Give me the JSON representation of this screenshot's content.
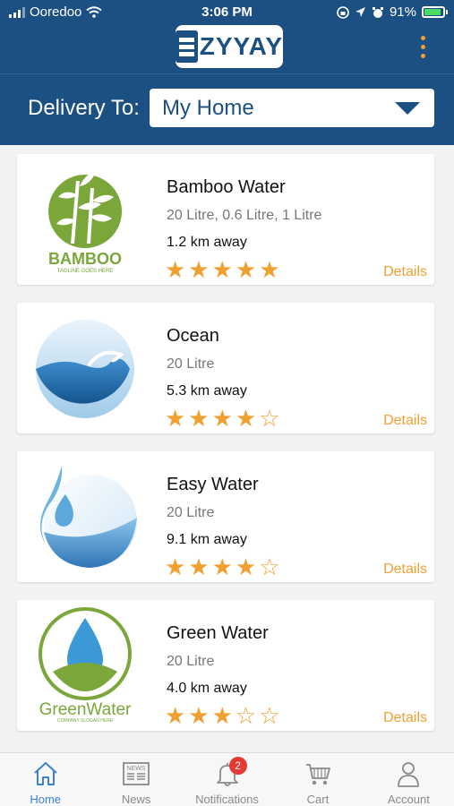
{
  "status_bar": {
    "carrier": "Ooredoo",
    "time": "3:06 PM",
    "battery": "91%"
  },
  "header": {
    "logo_text": "ZYYAY",
    "delivery_label": "Delivery To:",
    "delivery_value": "My Home"
  },
  "colors": {
    "brand": "#1c5083",
    "accent": "#f0a030",
    "active_tab": "#3b82d6",
    "badge": "#e53935"
  },
  "suppliers": [
    {
      "name": "Bamboo Water",
      "sizes": "20 Litre, 0.6 Litre, 1 Litre",
      "distance": "1.2 km away",
      "rating": 5,
      "rating_stars": "★★★★★",
      "details": "Details",
      "logo_text": "BAMBOO",
      "logo_tagline": "TAGLINE GOES HERE"
    },
    {
      "name": "Ocean",
      "sizes": "20 Litre",
      "distance": "5.3 km away",
      "rating": 4,
      "rating_stars": "★★★★☆",
      "details": "Details"
    },
    {
      "name": "Easy Water",
      "sizes": "20 Litre",
      "distance": "9.1 km away",
      "rating": 4,
      "rating_stars": "★★★★☆",
      "details": "Details"
    },
    {
      "name": "Green Water",
      "sizes": "20 Litre",
      "distance": "4.0 km away",
      "rating": 3,
      "rating_stars": "★★★☆☆",
      "details": "Details",
      "logo_text": "GreenWater",
      "logo_tagline": "COMPANY SLOGAN HERE"
    }
  ],
  "tabbar": {
    "items": [
      {
        "label": "Home",
        "icon": "home-icon",
        "active": true
      },
      {
        "label": "News",
        "icon": "news-icon",
        "icon_text": "NEWS"
      },
      {
        "label": "Notifications",
        "icon": "bell-icon",
        "badge": "2"
      },
      {
        "label": "Cart",
        "icon": "cart-icon"
      },
      {
        "label": "Account",
        "icon": "account-icon"
      }
    ]
  }
}
